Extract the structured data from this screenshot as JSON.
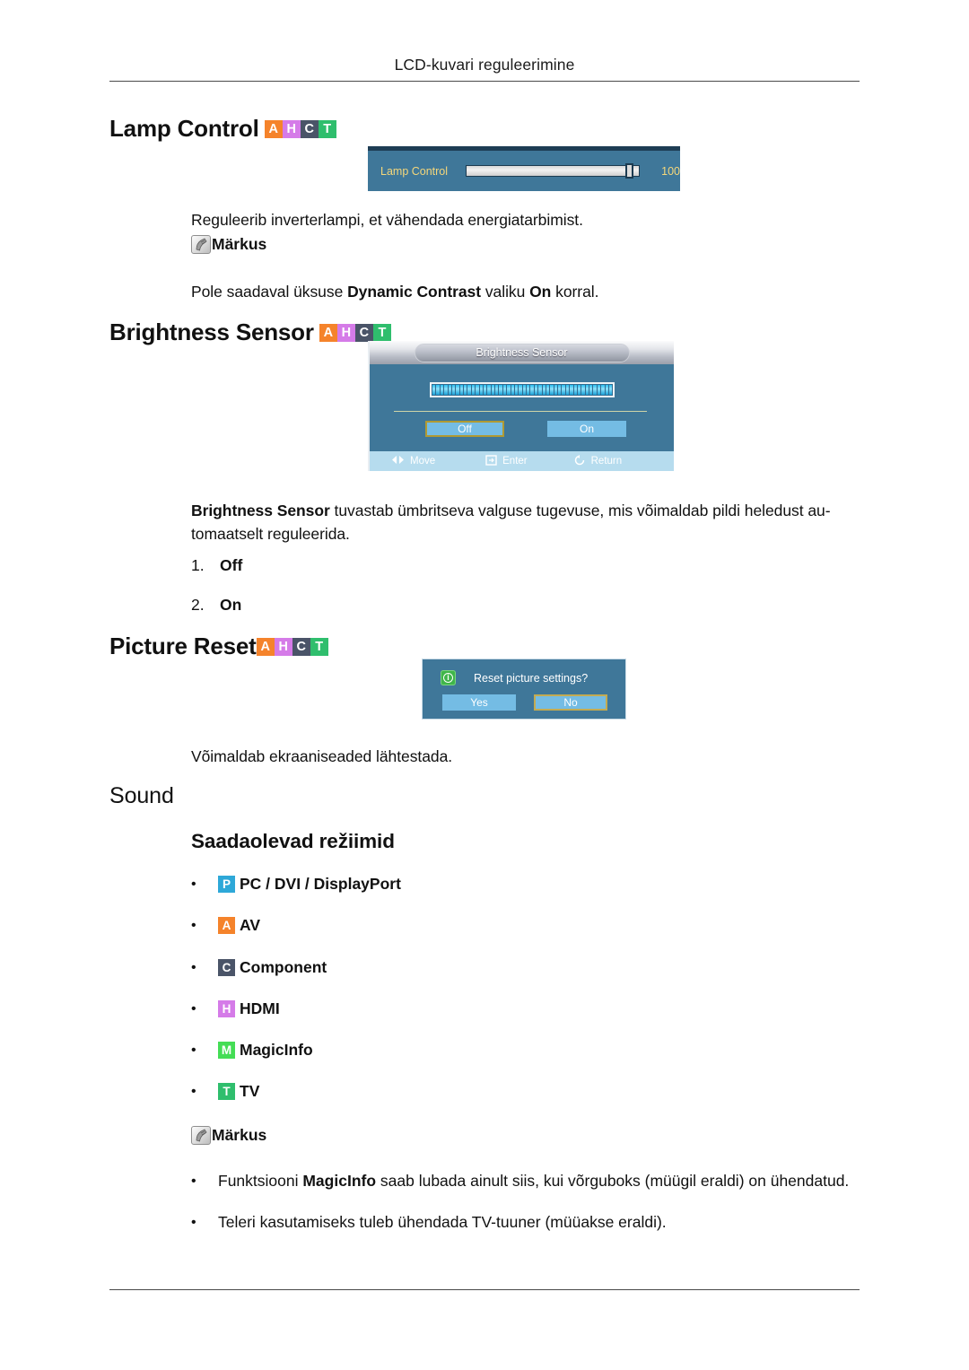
{
  "header": {
    "running_title": "LCD-kuvari reguleerimine"
  },
  "badge_colors": {
    "A": "#f5832b",
    "H": "#d57be8",
    "C": "#4a5468",
    "T": "#2fbe6d",
    "P": "#2ea8d8",
    "M": "#44dd55"
  },
  "sections": {
    "lamp_control": {
      "heading": "Lamp Control",
      "badges": [
        "A",
        "H",
        "C",
        "T"
      ],
      "osd": {
        "label": "Lamp Control",
        "value": "100",
        "slider_percent": 97
      },
      "description": "Reguleerib inverterlampi, et vähendada energiatarbimist.",
      "note_label": "Märkus",
      "note_text_pre": "Pole saadaval üksuse ",
      "note_bold_1": "Dynamic Contrast",
      "note_text_mid": " valiku ",
      "note_bold_2": "On",
      "note_text_post": " korral."
    },
    "brightness_sensor": {
      "heading": "Brightness Sensor",
      "badges": [
        "A",
        "H",
        "C",
        "T"
      ],
      "osd": {
        "title": "Brightness Sensor",
        "buttons": [
          {
            "label": "Off",
            "selected": true
          },
          {
            "label": "On",
            "selected": false
          }
        ],
        "footer": [
          {
            "icon": "move-icon",
            "label": "Move"
          },
          {
            "icon": "enter-icon",
            "label": "Enter"
          },
          {
            "icon": "return-icon",
            "label": "Return"
          }
        ],
        "meter_segments": 46
      },
      "description_bold": "Brightness Sensor",
      "description_rest": " tuvastab ümbritseva valguse tugevuse, mis võimaldab pildi heledust au-tomaatselt reguleerida.",
      "options": [
        {
          "num": "1.",
          "label": "Off"
        },
        {
          "num": "2.",
          "label": "On"
        }
      ]
    },
    "picture_reset": {
      "heading": "Picture Reset",
      "badges": [
        "A",
        "H",
        "C",
        "T"
      ],
      "osd": {
        "message": "Reset picture settings?",
        "info_glyph": "i",
        "buttons": [
          {
            "label": "Yes",
            "selected": false
          },
          {
            "label": "No",
            "selected": true
          }
        ]
      },
      "description": "Võimaldab ekraaniseaded lähtestada."
    },
    "sound": {
      "heading": "Sound",
      "subheading": "Saadaolevad režiimid",
      "modes": [
        {
          "badge": "P",
          "label": "PC / DVI / DisplayPort"
        },
        {
          "badge": "A",
          "label": "AV"
        },
        {
          "badge": "C",
          "label": "Component"
        },
        {
          "badge": "H",
          "label": "HDMI"
        },
        {
          "badge": "M",
          "label": "MagicInfo"
        },
        {
          "badge": "T",
          "label": "TV"
        }
      ],
      "note_label": "Märkus",
      "notes": [
        {
          "pre": "Funktsiooni ",
          "bold": "MagicInfo",
          "post": " saab lubada ainult siis, kui võrguboks (müügil eraldi) on ühendatud."
        },
        {
          "pre": "Teleri kasutamiseks tuleb ühendada TV-tuuner (müüakse eraldi).",
          "bold": "",
          "post": ""
        }
      ]
    }
  }
}
